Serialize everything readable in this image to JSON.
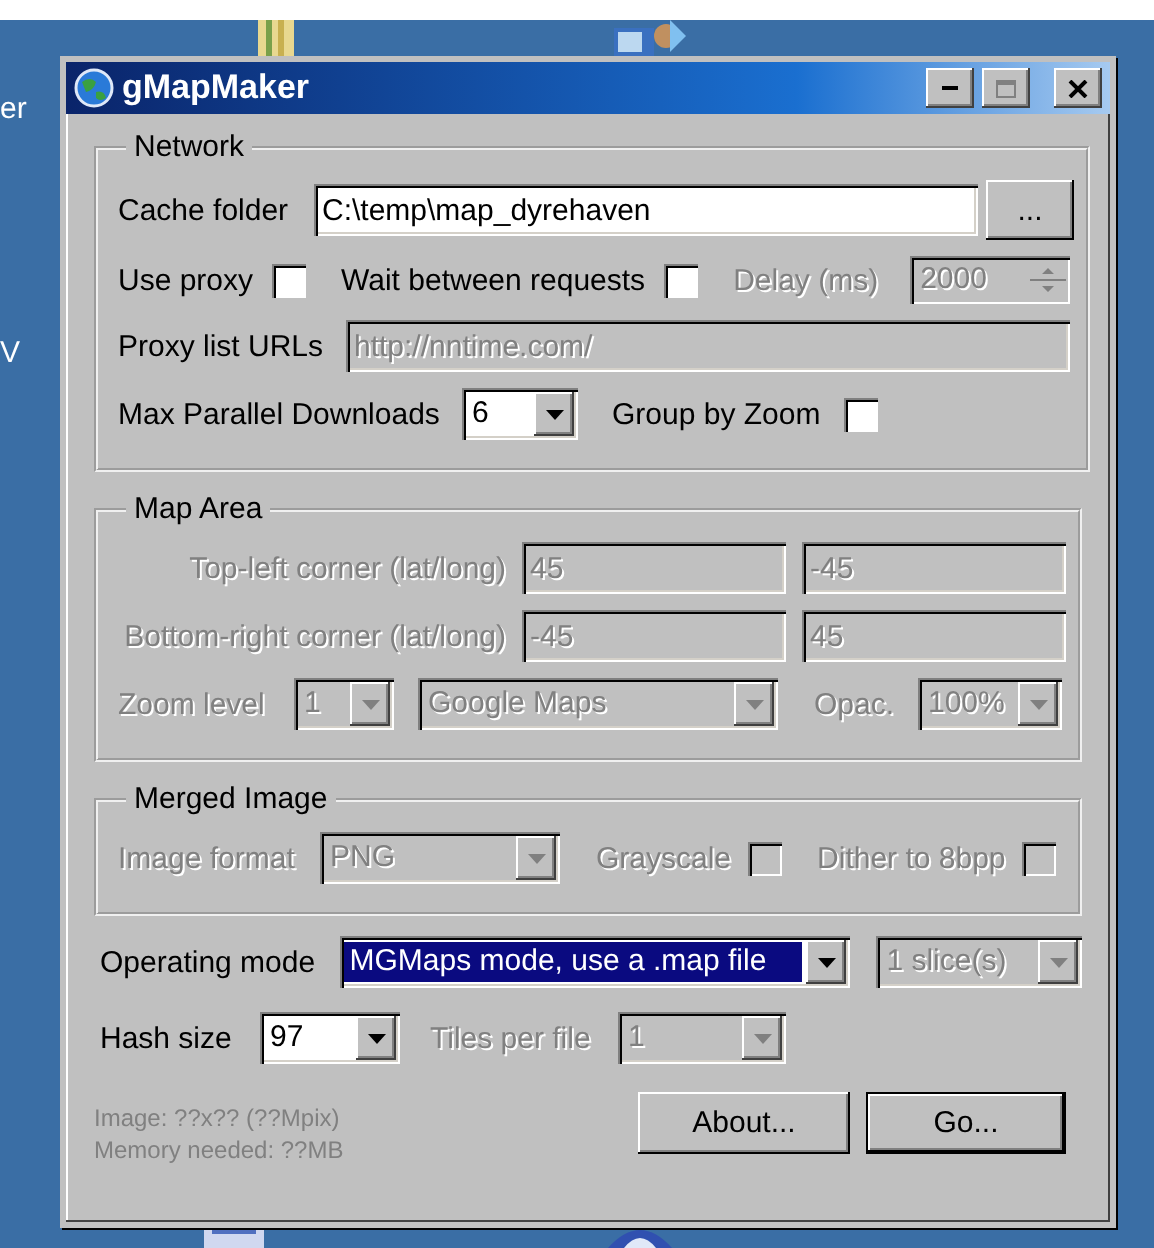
{
  "desktop": {
    "labels": [
      {
        "text": "er"
      },
      {
        "text": "V"
      }
    ]
  },
  "window": {
    "title": "gMapMaker"
  },
  "network": {
    "title": "Network",
    "cache_folder": {
      "label": "Cache folder",
      "value": "C:\\temp\\map_dyrehaven"
    },
    "browse_button": {
      "label": "..."
    },
    "use_proxy": {
      "label": "Use proxy",
      "checked": false
    },
    "wait_between_requests": {
      "label": "Wait between requests",
      "checked": false
    },
    "delay": {
      "label": "Delay (ms)",
      "value": "2000",
      "disabled": true
    },
    "proxy_list_urls": {
      "label": "Proxy list URLs",
      "value": "http://nntime.com/",
      "disabled": true
    },
    "max_parallel_downloads": {
      "label": "Max Parallel Downloads",
      "value": "6"
    },
    "group_by_zoom": {
      "label": "Group by Zoom",
      "checked": false
    }
  },
  "map_area": {
    "title": "Map Area",
    "disabled": true,
    "top_left": {
      "label": "Top-left corner (lat/long)",
      "lat": "45",
      "long": "-45"
    },
    "bottom_right": {
      "label": "Bottom-right corner (lat/long)",
      "lat": "-45",
      "long": "45"
    },
    "zoom_level": {
      "label": "Zoom level",
      "value": "1"
    },
    "map_source": {
      "value": "Google Maps"
    },
    "opacity": {
      "label": "Opac.",
      "value": "100%"
    }
  },
  "merged_image": {
    "title": "Merged Image",
    "disabled": true,
    "image_format": {
      "label": "Image format",
      "value": "PNG"
    },
    "grayscale": {
      "label": "Grayscale",
      "checked": false
    },
    "dither": {
      "label": "Dither to 8bpp",
      "checked": false
    }
  },
  "operating_mode": {
    "label": "Operating mode",
    "value": "MGMaps mode, use a .map file",
    "focused": true
  },
  "slices": {
    "value": "1 slice(s)",
    "disabled": true
  },
  "hash_size": {
    "label": "Hash size",
    "value": "97"
  },
  "tiles_per_file": {
    "label": "Tiles per file",
    "value": "1",
    "disabled": true
  },
  "status": [
    "Image: ??x?? (??Mpix)",
    "Memory needed: ??MB"
  ],
  "buttons": [
    {
      "label": "About...",
      "default": false
    },
    {
      "label": "Go...",
      "default": true
    }
  ]
}
